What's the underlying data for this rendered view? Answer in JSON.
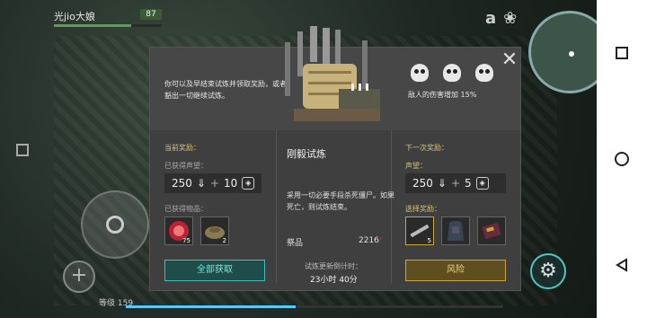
{
  "hud": {
    "player_name": "光jio大娘",
    "hp_value": "87",
    "hp_fraction": 0.72,
    "icon_a": "a",
    "level_text": "等级 159",
    "xp_fraction": 0.45
  },
  "modal": {
    "description": "你可以及早结束试炼并领取奖励，或者豁出一切继续试炼。",
    "damage_text": "敌人的伤害增加 15%",
    "title": "刚毅试炼",
    "center_desc": "采用一切必要手段杀死僵尸。如果死亡，则试炼结束。",
    "materials_label": "祭品",
    "materials_value": "2216",
    "timer_label": "试炼更新倒计时：",
    "timer_value": "23小时 40分",
    "current": {
      "section_label": "当前奖励：",
      "rep_label": "已获得声望：",
      "rep_value": "250",
      "rep_plus": "10",
      "items_label": "已获得物品：",
      "items": [
        {
          "icon": "red-chip-icon",
          "count": "75"
        },
        {
          "icon": "landmine-icon",
          "count": "2"
        }
      ],
      "claim_label": "全部获取"
    },
    "next": {
      "section_label": "下一次奖励：",
      "rep_label": "声望：",
      "rep_value": "250",
      "rep_plus": "5",
      "choose_label": "选择奖励：",
      "items": [
        {
          "icon": "pipe-icon",
          "count": "5"
        },
        {
          "icon": "armor-vest-icon",
          "count": ""
        },
        {
          "icon": "card-icon",
          "count": ""
        }
      ],
      "risk_label": "风险"
    }
  },
  "colors": {
    "accent_teal": "#3fbfb5",
    "accent_gold": "#caa53a",
    "section_gold": "#d7c27a"
  }
}
